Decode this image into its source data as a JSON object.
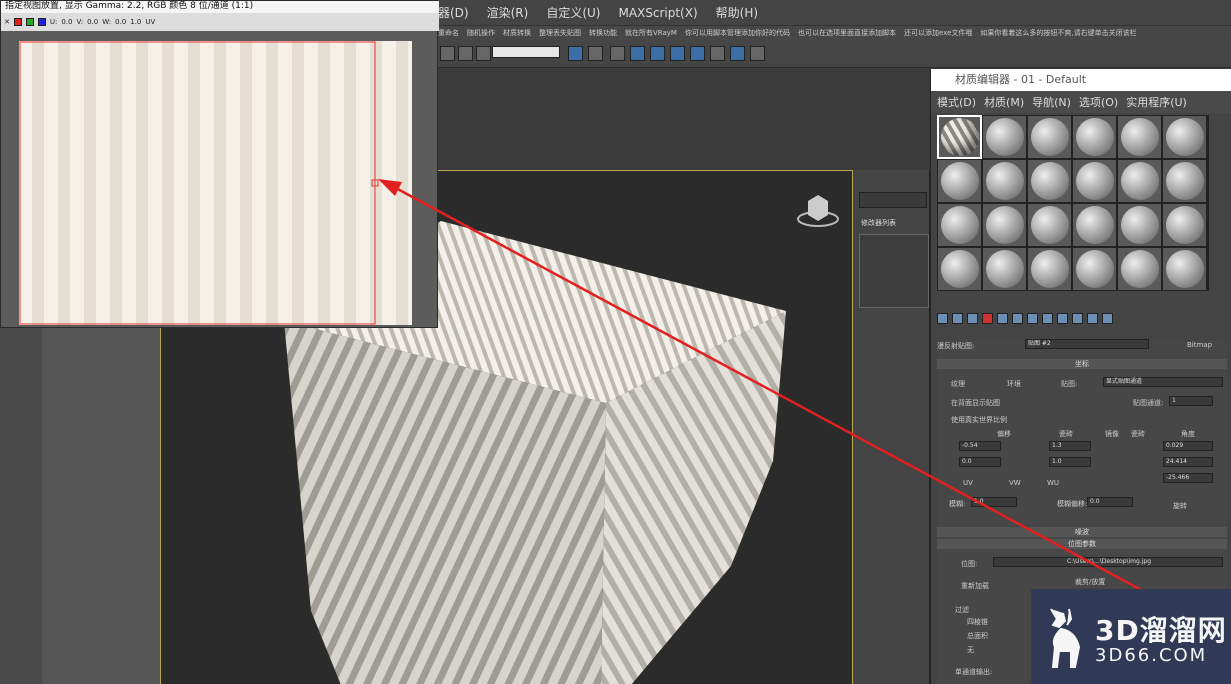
{
  "menubar": [
    "器(D)",
    "渲染(R)",
    "自定义(U)",
    "MAXScript(X)",
    "帮助(H)"
  ],
  "scriptbar": [
    "重命名",
    "随机操作",
    "材质转换",
    "整理丢失贴图",
    "转换功能",
    "就在所有VRayM",
    "你可以用脚本管理添加你好的代码",
    "也可以在选项里面直接添加脚本",
    "还可以添加exe文件哦",
    "如果你看着这么多的按钮不爽,请右键单击关闭该栏"
  ],
  "texwin": {
    "title": "指定视图放置, 显示 Gamma: 2.2, RGB 颜色 8 位/通道 (1:1)",
    "uv_label": "UV",
    "u_label": "U:",
    "v_label": "V:",
    "w_label": "W:",
    "u_val": "0.0",
    "v_val": "0.0",
    "w_val": "0.0",
    "h_val": "1.0"
  },
  "mated": {
    "title": "材质编辑器 - 01 - Default",
    "menu": [
      "模式(D)",
      "材质(M)",
      "导航(N)",
      "选项(O)",
      "实用程序(U)"
    ],
    "map_label": "漫反射贴图:",
    "map_name": "贴图 #2",
    "map_type": "Bitmap",
    "coords_header": "坐标",
    "texture_label": "纹理",
    "env_label": "环境",
    "mapping_label": "贴图:",
    "mapping_value": "显式贴图通道",
    "show_map_label": "在背面显示贴图",
    "channel_label": "贴图通道:",
    "channel_value": "1",
    "real_world_label": "使用真实世界比例",
    "col_offset": "偏移",
    "col_tiling": "瓷砖",
    "col_mirror": "镜像",
    "col_tile": "瓷砖",
    "col_angle": "角度",
    "u_offset": "-0.54",
    "v_offset": "0.0",
    "u_tiling": "1.3",
    "v_tiling": "1.0",
    "u_angle": "0.029",
    "v_angle": "24.414",
    "w_angle": "-25.466",
    "uv": "UV",
    "vw": "VW",
    "wu": "WU",
    "blur_label": "模糊:",
    "blur_value": "1.0",
    "blur_offset_label": "模糊偏移:",
    "blur_offset_value": "0.0",
    "rotate_button": "旋转",
    "noise_header": "噪波",
    "bitmap_header": "位图参数",
    "bitmap_label": "位图:",
    "bitmap_path": "C:\\Users\\...\\Desktop\\img.jpg",
    "reload_button": "重新加载",
    "crop_label": "裁剪/放置",
    "filter_label": "过滤",
    "filter_pyramidal": "四棱锥",
    "filter_sat": "总面积",
    "filter_none": "无",
    "mono_label": "单通道输出:"
  },
  "sidestrip": {
    "list_label": "修改器列表"
  },
  "watermark": {
    "line1": "3D溜溜网",
    "line2": "3D66.COM"
  }
}
